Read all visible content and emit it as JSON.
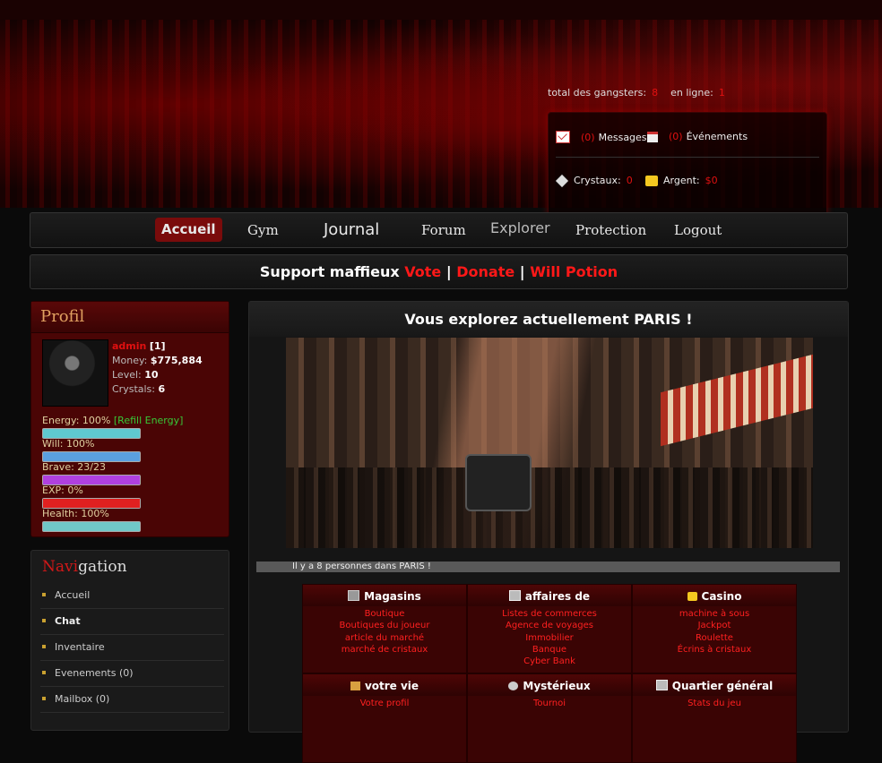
{
  "header": {
    "total_label": "total des gangsters:",
    "total_value": "8",
    "online_label": "en ligne:",
    "online_value": "1",
    "messages_count": "(0)",
    "messages_label": "Messages",
    "events_count": "(0)",
    "events_label": "Événements",
    "crystals_label": "Crystaux:",
    "crystals_value": "0",
    "money_label": "Argent:",
    "money_value": "$0"
  },
  "nav": {
    "accueil": "Accueil",
    "gym": "Gym",
    "journal": "Journal",
    "forum": "Forum",
    "explorer": "Explorer",
    "protection": "Protection",
    "logout": "Logout"
  },
  "support": {
    "prefix": "Support maffieux",
    "vote": "Vote",
    "donate": "Donate",
    "will": "Will Potion",
    "sep": "|"
  },
  "profile": {
    "title": "Profil",
    "name": "admin",
    "id": "[1]",
    "money_label": "Money:",
    "money": "$775,884",
    "level_label": "Level:",
    "level": "10",
    "crystals_label": "Crystals:",
    "crystals": "6",
    "bars": [
      {
        "label": "Energy: 100%",
        "extra": "[Refill Energy]",
        "color": "#5fc9d0",
        "fill": 1.0
      },
      {
        "label": "Will: 100%",
        "extra": "",
        "color": "#5aa0e0",
        "fill": 1.0
      },
      {
        "label": "Brave: 23/23",
        "extra": "",
        "color": "#b040e0",
        "fill": 1.0
      },
      {
        "label": "EXP: 0%",
        "extra": "",
        "color": "#e02020",
        "fill": 1.0
      },
      {
        "label": "Health: 100%",
        "extra": "",
        "color": "#70c8c8",
        "fill": 1.0
      }
    ]
  },
  "navigation": {
    "title_red": "Navi",
    "title_rest": "gation",
    "items": [
      "Accueil",
      "Chat",
      "Inventaire",
      "Evenements (0)",
      "Mailbox (0)"
    ]
  },
  "main": {
    "title": "Vous explorez actuellement PARIS !",
    "people": "Il y a 8 personnes dans PARIS !",
    "cells": [
      {
        "title": "Magasins",
        "icon": "shop-icon",
        "links": [
          "Boutique",
          "Boutiques du joueur",
          "article du marché",
          "marché de cristaux"
        ]
      },
      {
        "title": "affaires de",
        "icon": "business-icon",
        "links": [
          "Listes de commerces",
          "Agence de voyages",
          "Immobilier",
          "Banque",
          "Cyber Bank"
        ]
      },
      {
        "title": "Casino",
        "icon": "coins-icon",
        "links": [
          "machine à sous",
          "Jackpot",
          "Roulette",
          "Écrins à cristaux"
        ]
      },
      {
        "title": "votre vie",
        "icon": "scroll-icon",
        "links": [
          "Votre profil"
        ]
      },
      {
        "title": "Mystérieux",
        "icon": "mystery-icon",
        "links": [
          "Tournoi"
        ]
      },
      {
        "title": "Quartier général",
        "icon": "hq-icon",
        "links": [
          "Stats du jeu"
        ]
      }
    ]
  }
}
